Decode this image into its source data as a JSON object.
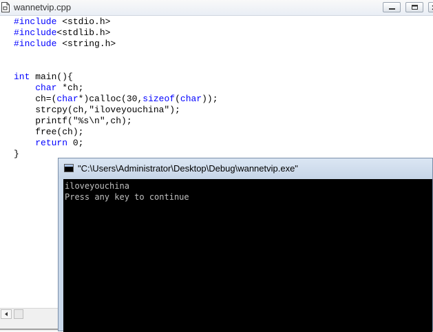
{
  "editor": {
    "title": "wannetvip.cpp",
    "code_lines": [
      [
        {
          "t": "#include",
          "k": 1
        },
        {
          "t": " <stdio.h>",
          "k": 0
        }
      ],
      [
        {
          "t": "#include",
          "k": 1
        },
        {
          "t": "<stdlib.h>",
          "k": 0
        }
      ],
      [
        {
          "t": "#include",
          "k": 1
        },
        {
          "t": " <string.h>",
          "k": 0
        }
      ],
      [],
      [],
      [
        {
          "t": "int",
          "k": 1
        },
        {
          "t": " main(){",
          "k": 0
        }
      ],
      [
        {
          "t": "    ",
          "k": 0
        },
        {
          "t": "char",
          "k": 1
        },
        {
          "t": " *ch;",
          "k": 0
        }
      ],
      [
        {
          "t": "    ch=(",
          "k": 0
        },
        {
          "t": "char",
          "k": 1
        },
        {
          "t": "*)calloc(30,",
          "k": 0
        },
        {
          "t": "sizeof",
          "k": 1
        },
        {
          "t": "(",
          "k": 0
        },
        {
          "t": "char",
          "k": 1
        },
        {
          "t": "));",
          "k": 0
        }
      ],
      [
        {
          "t": "    strcpy(ch,\"iloveyouchina\");",
          "k": 0
        }
      ],
      [
        {
          "t": "    printf(\"%s\\n\",ch);",
          "k": 0
        }
      ],
      [
        {
          "t": "    free(ch);",
          "k": 0
        }
      ],
      [
        {
          "t": "    ",
          "k": 0
        },
        {
          "t": "return",
          "k": 1
        },
        {
          "t": " 0;",
          "k": 0
        }
      ],
      [
        {
          "t": "}",
          "k": 0
        }
      ]
    ]
  },
  "console": {
    "title": "\"C:\\Users\\Administrator\\Desktop\\Debug\\wannetvip.exe\"",
    "output_line_1": "iloveyouchina",
    "output_line_2": "Press any key to continue"
  },
  "colors": {
    "keyword": "#0000ff",
    "console_bg": "#000000",
    "console_text": "#c0c0c0"
  }
}
